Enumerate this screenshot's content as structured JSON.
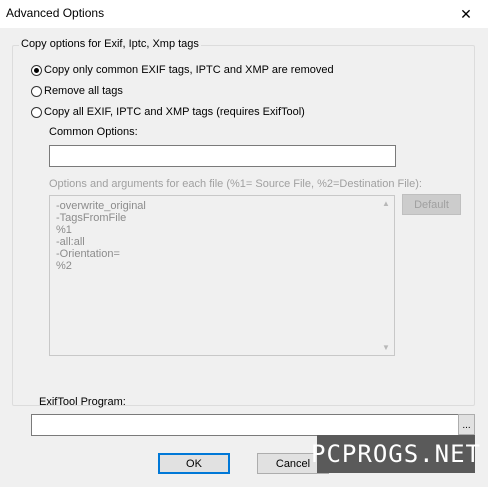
{
  "window": {
    "title": "Advanced Options",
    "close_glyph": "✕"
  },
  "group": {
    "label": "Copy options for Exif, Iptc, Xmp tags",
    "options": [
      {
        "label": "Copy only common EXIF tags, IPTC and XMP are removed",
        "checked": true
      },
      {
        "label": "Remove all tags",
        "checked": false
      },
      {
        "label": "Copy all EXIF, IPTC and XMP tags (requires ExifTool)",
        "checked": false
      }
    ],
    "common_options_label": "Common Options:",
    "common_options_value": "",
    "args_label": "Options and arguments for each file (%1= Source File, %2=Destination File):",
    "args_lines": [
      "-overwrite_original",
      "-TagsFromFile",
      "%1",
      "-all:all",
      "-Orientation=",
      "%2"
    ],
    "default_button": "Default",
    "scroll_up": "▲",
    "scroll_down": "▼"
  },
  "exiftool": {
    "label": "ExifTool Program:",
    "value": "",
    "browse_label": "..."
  },
  "buttons": {
    "ok": "OK",
    "cancel": "Cancel"
  },
  "watermark": "PCPROGS.NET"
}
